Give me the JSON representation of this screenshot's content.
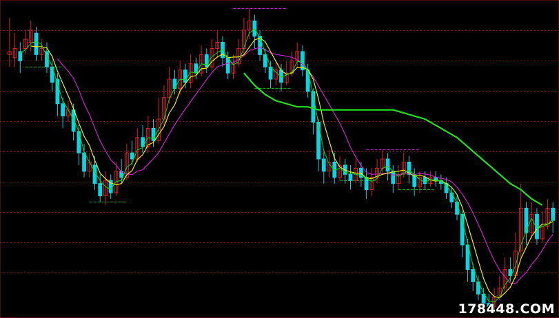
{
  "watermark": "178448.COM",
  "colors": {
    "background": "#000000",
    "grid": "#8b1a1a",
    "up_candle": "#e02020",
    "down_candle": "#00d8e8",
    "ma_short": "#f0f000",
    "ma_mid": "#00e000",
    "ma_long": "#d020d0",
    "ma_trend": "#20e020",
    "support_line": "#00c000",
    "resistance_line": "#d020d0"
  },
  "chart_data": {
    "type": "candlestick",
    "title": "",
    "xlabel": "",
    "ylabel": "",
    "grid": "horizontal-dotted",
    "ylim": [
      0,
      100
    ],
    "candles": [
      {
        "o": 84,
        "c": 85,
        "h": 96,
        "l": 80
      },
      {
        "o": 83,
        "c": 86,
        "h": 91,
        "l": 80
      },
      {
        "o": 85,
        "c": 82,
        "h": 88,
        "l": 78
      },
      {
        "o": 86,
        "c": 89,
        "h": 92,
        "l": 84
      },
      {
        "o": 88,
        "c": 92,
        "h": 95,
        "l": 85
      },
      {
        "o": 91,
        "c": 84,
        "h": 93,
        "l": 82
      },
      {
        "o": 84,
        "c": 86,
        "h": 89,
        "l": 82
      },
      {
        "o": 85,
        "c": 80,
        "h": 88,
        "l": 78
      },
      {
        "o": 80,
        "c": 75,
        "h": 82,
        "l": 72
      },
      {
        "o": 76,
        "c": 68,
        "h": 78,
        "l": 64
      },
      {
        "o": 68,
        "c": 64,
        "h": 70,
        "l": 60
      },
      {
        "o": 64,
        "c": 66,
        "h": 69,
        "l": 62
      },
      {
        "o": 66,
        "c": 59,
        "h": 68,
        "l": 56
      },
      {
        "o": 59,
        "c": 52,
        "h": 61,
        "l": 48
      },
      {
        "o": 52,
        "c": 46,
        "h": 55,
        "l": 44
      },
      {
        "o": 46,
        "c": 49,
        "h": 52,
        "l": 44
      },
      {
        "o": 48,
        "c": 42,
        "h": 51,
        "l": 40
      },
      {
        "o": 42,
        "c": 38,
        "h": 45,
        "l": 36
      },
      {
        "o": 38,
        "c": 43,
        "h": 46,
        "l": 35
      },
      {
        "o": 43,
        "c": 39,
        "h": 45,
        "l": 37
      },
      {
        "o": 39,
        "c": 46,
        "h": 49,
        "l": 38
      },
      {
        "o": 46,
        "c": 44,
        "h": 50,
        "l": 42
      },
      {
        "o": 44,
        "c": 52,
        "h": 55,
        "l": 43
      },
      {
        "o": 52,
        "c": 50,
        "h": 56,
        "l": 48
      },
      {
        "o": 50,
        "c": 57,
        "h": 60,
        "l": 49
      },
      {
        "o": 57,
        "c": 54,
        "h": 61,
        "l": 52
      },
      {
        "o": 54,
        "c": 60,
        "h": 64,
        "l": 52
      },
      {
        "o": 60,
        "c": 56,
        "h": 63,
        "l": 54
      },
      {
        "o": 56,
        "c": 63,
        "h": 70,
        "l": 55
      },
      {
        "o": 63,
        "c": 70,
        "h": 74,
        "l": 61
      },
      {
        "o": 70,
        "c": 76,
        "h": 80,
        "l": 68
      },
      {
        "o": 76,
        "c": 73,
        "h": 79,
        "l": 71
      },
      {
        "o": 73,
        "c": 79,
        "h": 82,
        "l": 71
      },
      {
        "o": 79,
        "c": 75,
        "h": 81,
        "l": 73
      },
      {
        "o": 75,
        "c": 81,
        "h": 84,
        "l": 73
      },
      {
        "o": 81,
        "c": 78,
        "h": 83,
        "l": 76
      },
      {
        "o": 78,
        "c": 84,
        "h": 87,
        "l": 77
      },
      {
        "o": 84,
        "c": 80,
        "h": 86,
        "l": 78
      },
      {
        "o": 80,
        "c": 86,
        "h": 89,
        "l": 79
      },
      {
        "o": 86,
        "c": 88,
        "h": 92,
        "l": 83
      },
      {
        "o": 88,
        "c": 83,
        "h": 90,
        "l": 80
      },
      {
        "o": 83,
        "c": 78,
        "h": 85,
        "l": 76
      },
      {
        "o": 78,
        "c": 81,
        "h": 84,
        "l": 76
      },
      {
        "o": 81,
        "c": 86,
        "h": 89,
        "l": 80
      },
      {
        "o": 86,
        "c": 92,
        "h": 96,
        "l": 84
      },
      {
        "o": 92,
        "c": 95,
        "h": 99,
        "l": 89
      },
      {
        "o": 95,
        "c": 90,
        "h": 97,
        "l": 86
      },
      {
        "o": 90,
        "c": 84,
        "h": 92,
        "l": 82
      },
      {
        "o": 84,
        "c": 80,
        "h": 86,
        "l": 78
      },
      {
        "o": 80,
        "c": 76,
        "h": 82,
        "l": 73
      },
      {
        "o": 76,
        "c": 79,
        "h": 82,
        "l": 74
      },
      {
        "o": 79,
        "c": 75,
        "h": 81,
        "l": 72
      },
      {
        "o": 75,
        "c": 78,
        "h": 82,
        "l": 74
      },
      {
        "o": 78,
        "c": 82,
        "h": 85,
        "l": 77
      },
      {
        "o": 82,
        "c": 85,
        "h": 88,
        "l": 80
      },
      {
        "o": 85,
        "c": 79,
        "h": 87,
        "l": 77
      },
      {
        "o": 79,
        "c": 72,
        "h": 81,
        "l": 70
      },
      {
        "o": 72,
        "c": 62,
        "h": 73,
        "l": 58
      },
      {
        "o": 62,
        "c": 50,
        "h": 63,
        "l": 46
      },
      {
        "o": 50,
        "c": 46,
        "h": 53,
        "l": 42
      },
      {
        "o": 46,
        "c": 49,
        "h": 53,
        "l": 44
      },
      {
        "o": 49,
        "c": 44,
        "h": 52,
        "l": 42
      },
      {
        "o": 44,
        "c": 48,
        "h": 51,
        "l": 43
      },
      {
        "o": 48,
        "c": 45,
        "h": 50,
        "l": 42
      },
      {
        "o": 45,
        "c": 43,
        "h": 48,
        "l": 40
      },
      {
        "o": 43,
        "c": 47,
        "h": 50,
        "l": 42
      },
      {
        "o": 47,
        "c": 44,
        "h": 49,
        "l": 41
      },
      {
        "o": 44,
        "c": 40,
        "h": 47,
        "l": 37
      },
      {
        "o": 40,
        "c": 44,
        "h": 47,
        "l": 38
      },
      {
        "o": 44,
        "c": 47,
        "h": 50,
        "l": 42
      },
      {
        "o": 47,
        "c": 50,
        "h": 53,
        "l": 45
      },
      {
        "o": 50,
        "c": 46,
        "h": 52,
        "l": 43
      },
      {
        "o": 46,
        "c": 42,
        "h": 48,
        "l": 39
      },
      {
        "o": 42,
        "c": 45,
        "h": 48,
        "l": 40
      },
      {
        "o": 45,
        "c": 49,
        "h": 52,
        "l": 44
      },
      {
        "o": 49,
        "c": 45,
        "h": 51,
        "l": 42
      },
      {
        "o": 45,
        "c": 41,
        "h": 47,
        "l": 38
      },
      {
        "o": 41,
        "c": 44,
        "h": 46,
        "l": 39
      },
      {
        "o": 44,
        "c": 42,
        "h": 46,
        "l": 40
      },
      {
        "o": 42,
        "c": 44,
        "h": 46,
        "l": 41
      },
      {
        "o": 44,
        "c": 43,
        "h": 46,
        "l": 41
      },
      {
        "o": 43,
        "c": 42,
        "h": 45,
        "l": 40
      },
      {
        "o": 42,
        "c": 39,
        "h": 44,
        "l": 37
      },
      {
        "o": 39,
        "c": 36,
        "h": 41,
        "l": 34
      },
      {
        "o": 36,
        "c": 32,
        "h": 38,
        "l": 30
      },
      {
        "o": 32,
        "c": 22,
        "h": 33,
        "l": 18
      },
      {
        "o": 22,
        "c": 14,
        "h": 24,
        "l": 10
      },
      {
        "o": 14,
        "c": 10,
        "h": 16,
        "l": 7
      },
      {
        "o": 10,
        "c": 6,
        "h": 12,
        "l": 4
      },
      {
        "o": 6,
        "c": 3,
        "h": 8,
        "l": 0
      },
      {
        "o": 3,
        "c": 2,
        "h": 6,
        "l": 0
      },
      {
        "o": 2,
        "c": 5,
        "h": 8,
        "l": 1
      },
      {
        "o": 5,
        "c": 8,
        "h": 12,
        "l": 4
      },
      {
        "o": 8,
        "c": 14,
        "h": 18,
        "l": 7
      },
      {
        "o": 14,
        "c": 12,
        "h": 18,
        "l": 10
      },
      {
        "o": 12,
        "c": 20,
        "h": 26,
        "l": 11
      },
      {
        "o": 20,
        "c": 34,
        "h": 42,
        "l": 18
      },
      {
        "o": 34,
        "c": 26,
        "h": 36,
        "l": 22
      },
      {
        "o": 26,
        "c": 32,
        "h": 36,
        "l": 24
      },
      {
        "o": 32,
        "c": 24,
        "h": 34,
        "l": 22
      },
      {
        "o": 24,
        "c": 28,
        "h": 33,
        "l": 23
      },
      {
        "o": 28,
        "c": 34,
        "h": 37,
        "l": 27
      },
      {
        "o": 34,
        "c": 30,
        "h": 36,
        "l": 26
      }
    ],
    "long_trend_line": {
      "start_index": 44,
      "values": [
        78,
        74,
        71,
        69,
        68,
        67,
        67,
        66,
        66,
        66,
        66,
        66,
        66,
        66,
        66,
        65,
        64,
        63,
        61,
        59,
        57,
        54,
        51,
        48,
        45,
        42,
        40,
        37,
        35
      ]
    },
    "support_markers": [
      {
        "index": 5,
        "value": 80
      },
      {
        "index": 17,
        "value": 36
      },
      {
        "index": 48,
        "value": 73
      },
      {
        "index": 64,
        "value": 43
      },
      {
        "index": 75,
        "value": 40
      }
    ],
    "resistance_markers": [
      {
        "index": 42,
        "value": 99
      },
      {
        "index": 67,
        "value": 53
      }
    ]
  }
}
